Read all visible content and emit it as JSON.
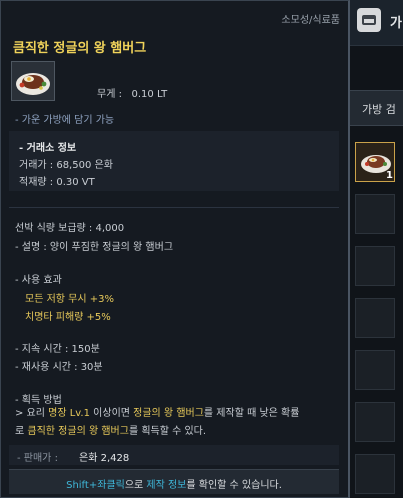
{
  "background": {
    "title_fragment": "가",
    "tab_label": "가방 검",
    "slot_count": "1"
  },
  "tooltip": {
    "category": "소모성/식료품",
    "title": "큼직한 정글의 왕 햄버그",
    "weight_label": "무게 :",
    "weight_value": "0.10 LT",
    "bag_note": "- 가운 가방에 담기 가능",
    "market": {
      "header": "- 거래소 정보",
      "price": "거래가 : 68,500 은화",
      "stock": "적재량 : 0.30 VT"
    },
    "feed": "선박 식량 보급량 : 4,000",
    "description": "- 설명 : 양이 푸짐한 정글의 왕 햄버그",
    "effect_header": "- 사용 효과",
    "effects": [
      "모든 저항 무시 +3%",
      "치명타 피해량 +5%"
    ],
    "duration": "- 지속 시간 : 150분",
    "cooldown": "- 재사용 시간 : 30분",
    "acquire_header": "- 획득 방법",
    "acquire_line1_pre": " > 요리 ",
    "acquire_line1_gold": "명장 Lv.1",
    "acquire_line1_mid": " 이상이면 ",
    "acquire_line1_gold2": "정글의 왕 햄버그",
    "acquire_line1_post": "를 제작할 때 낮은 확률",
    "acquire_line2_pre": "로 ",
    "acquire_line2_gold": "큼직한 정글의 왕 햄버그",
    "acquire_line2_post": "를 획득할 수 있다.",
    "sell_label": "- 판매가 :",
    "sell_value": "은화 2,428",
    "hint_key": "Shift+좌클릭",
    "hint_mid": "으로 ",
    "hint_link": "제작 정보",
    "hint_post": "를 확인할 수 있습니다."
  },
  "colors": {
    "title_gold": "#f0d35a",
    "effect_gold": "#e7c95a",
    "hint_cyan": "#3fb7d9",
    "note_blue": "#8fa3c1"
  }
}
